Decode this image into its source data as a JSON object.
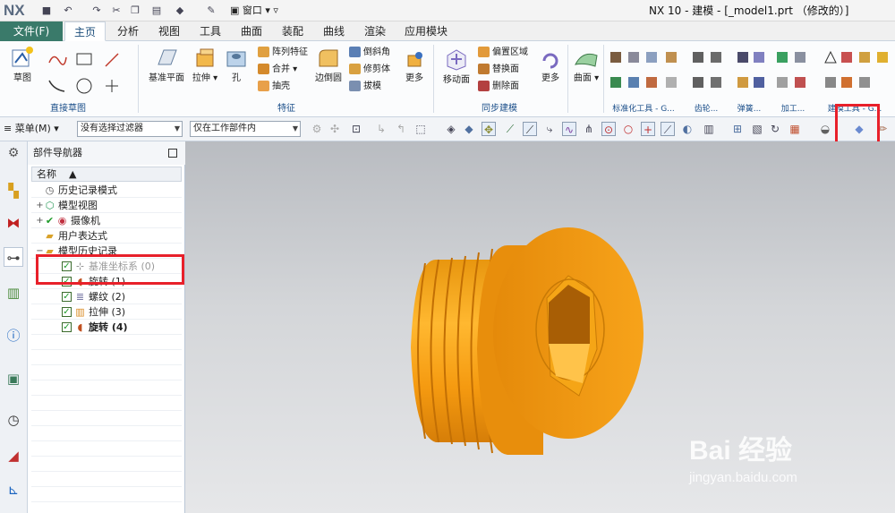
{
  "app": {
    "logo": "NX",
    "window_menu": "窗口",
    "title": "NX 10 - 建模 - [_model1.prt （修改的）]"
  },
  "menu_tabs": {
    "file": "文件(F)",
    "tabs": [
      "主页",
      "分析",
      "视图",
      "工具",
      "曲面",
      "装配",
      "曲线",
      "渲染",
      "应用模块"
    ],
    "active": "主页"
  },
  "ribbon": {
    "sketch": "草图",
    "datum_plane": "基准平面",
    "extrude": "拉伸",
    "hole": "孔",
    "pattern_feature": "阵列特征",
    "unite": "合并",
    "shell": "抽壳",
    "edge_blend": "边倒圆",
    "chamfer": "倒斜角",
    "trim_body": "修剪体",
    "draft": "拔模",
    "more1": "更多",
    "move_face": "移动面",
    "offset_region": "偏置区域",
    "replace_face": "替换面",
    "delete_face": "删除面",
    "more2": "更多",
    "surface": "曲面",
    "groups": {
      "direct_sketch": "直接草图",
      "feature": "特征",
      "sync_modeling": "同步建模",
      "standard_tools": "标准化工具 - G...",
      "gear": "齿轮...",
      "spring": "弹簧...",
      "machining": "加工...",
      "modeling": "建模工具 - G..."
    }
  },
  "toolbar2": {
    "menu": "菜单(M)",
    "filter": "没有选择过滤器",
    "scope": "仅在工作部件内"
  },
  "navigator": {
    "title": "部件导航器",
    "column": "名称",
    "items": [
      {
        "label": "历史记录模式",
        "icon": "clock-icon"
      },
      {
        "label": "模型视图",
        "icon": "model-views-icon"
      },
      {
        "label": "摄像机",
        "icon": "camera-icon"
      },
      {
        "label": "用户表达式",
        "icon": "folder-icon"
      },
      {
        "label": "模型历史记录",
        "icon": "folder-icon"
      },
      {
        "label": "基准坐标系 (0)",
        "icon": "datum-csys-icon"
      },
      {
        "label": "旋转 (1)",
        "icon": "revolve-icon"
      },
      {
        "label": "螺纹 (2)",
        "icon": "thread-icon"
      },
      {
        "label": "拉伸 (3)",
        "icon": "extrude-icon"
      },
      {
        "label": "旋转 (4)",
        "icon": "revolve-icon"
      }
    ]
  },
  "watermark": {
    "brand": "Bai 经验",
    "url": "jingyan.baidu.com"
  },
  "colors": {
    "accent": "#3a7a6a",
    "highlight": "#e8202a",
    "model": "#f5a31c"
  }
}
